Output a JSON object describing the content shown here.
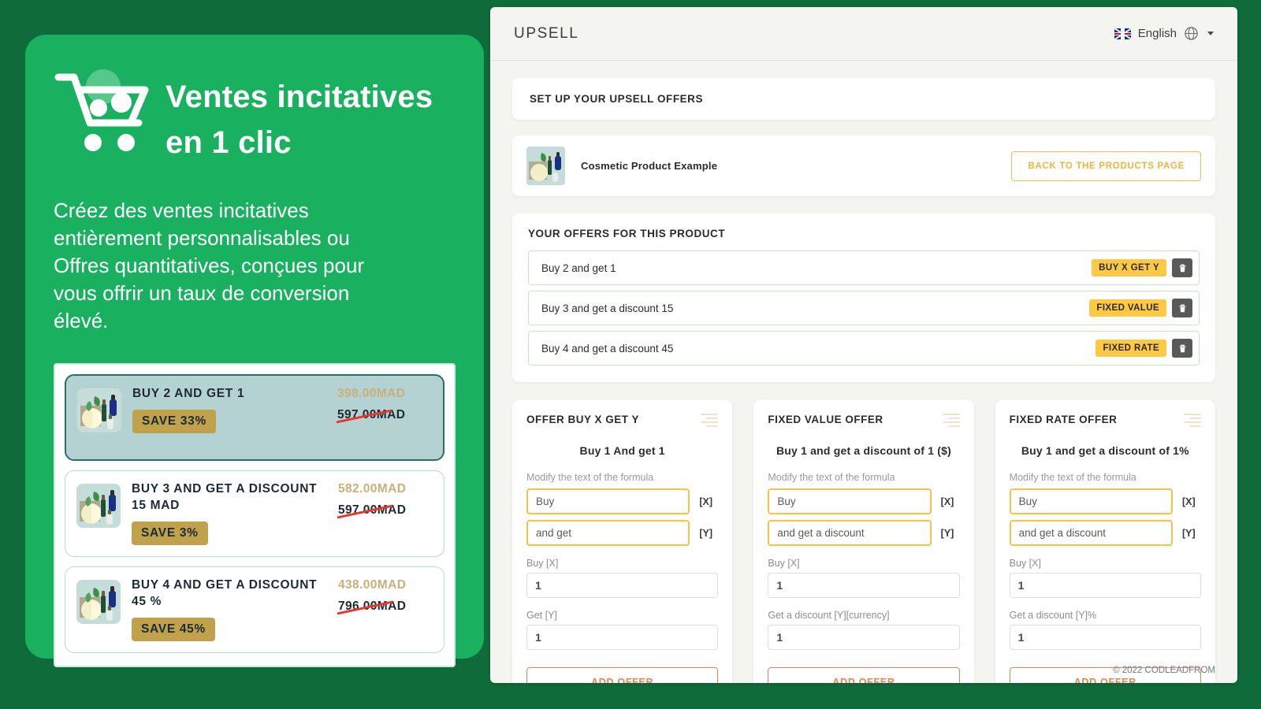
{
  "promo": {
    "icon": "shopping-cart-icon",
    "title_line1": "Ventes incitatives",
    "title_line2": "en 1 clic",
    "description": "Créez des ventes incitatives entièrement personnalisables ou Offres quantitatives, conçues pour vous offrir un taux de conversion élevé.",
    "preview_offers": [
      {
        "name": "BUY 2 AND GET 1",
        "save": "SAVE 33%",
        "price_new": "398.00MAD",
        "price_old": "597.00MAD",
        "selected": true
      },
      {
        "name": "BUY 3 AND GET A DISCOUNT 15 MAD",
        "save": "SAVE 3%",
        "price_new": "582.00MAD",
        "price_old": "597.00MAD",
        "selected": false
      },
      {
        "name": "BUY 4 AND GET A DISCOUNT 45 %",
        "save": "SAVE 45%",
        "price_new": "438.00MAD",
        "price_old": "796.00MAD",
        "selected": false
      }
    ]
  },
  "app": {
    "brand": "UPSELL",
    "language": "English",
    "flag": "uk-flag-icon",
    "globe": "globe-icon",
    "setup_title": "SET UP YOUR UPSELL OFFERS",
    "product": {
      "name": "Cosmetic Product Example",
      "back_button": "BACK TO THE PRODUCTS PAGE"
    },
    "offers_section": {
      "title": "YOUR OFFERS FOR THIS PRODUCT",
      "rows": [
        {
          "label": "Buy 2 and get 1",
          "badge": "BUY X GET Y",
          "delete_icon": "trash-icon"
        },
        {
          "label": "Buy 3 and get a discount 15",
          "badge": "FIXED VALUE",
          "delete_icon": "trash-icon"
        },
        {
          "label": "Buy 4 and get a discount 45",
          "badge": "FIXED RATE",
          "delete_icon": "trash-icon"
        }
      ]
    },
    "form_cards": [
      {
        "title": "OFFER BUY X GET Y",
        "formula": "Buy 1 And get 1",
        "hint": "Modify the text of the formula",
        "text1_value": "Buy",
        "tag1": "[X]",
        "text2_value": "and get",
        "tag2": "[Y]",
        "num1_label": "Buy [X]",
        "num1_value": "1",
        "num2_label": "Get [Y]",
        "num2_value": "1",
        "add_button": "ADD OFFER"
      },
      {
        "title": "FIXED VALUE OFFER",
        "formula": "Buy 1 and get a discount of 1 ($)",
        "hint": "Modify the text of the formula",
        "text1_value": "Buy",
        "tag1": "[X]",
        "text2_value": "and get a discount",
        "tag2": "[Y]",
        "num1_label": "Buy [X]",
        "num1_value": "1",
        "num2_label": "Get a discount [Y][currency]",
        "num2_value": "1",
        "add_button": "ADD OFFER"
      },
      {
        "title": "FIXED RATE OFFER",
        "formula": "Buy 1 and get a discount of 1%",
        "hint": "Modify the text of the formula",
        "text1_value": "Buy",
        "tag1": "[X]",
        "text2_value": "and get a discount",
        "tag2": "[Y]",
        "num1_label": "Buy [X]",
        "num1_value": "1",
        "num2_label": "Get a discount [Y]%",
        "num2_value": "1",
        "add_button": "ADD OFFER"
      }
    ],
    "footer": "© 2022 CODLEADFROM"
  },
  "colors": {
    "brand_green": "#19b05f",
    "page_green": "#0f6b3a",
    "badge_yellow": "#ffc845",
    "accent_orange": "#ef7f52",
    "input_yellow": "#f5c345",
    "gold": "#bfa24b"
  }
}
